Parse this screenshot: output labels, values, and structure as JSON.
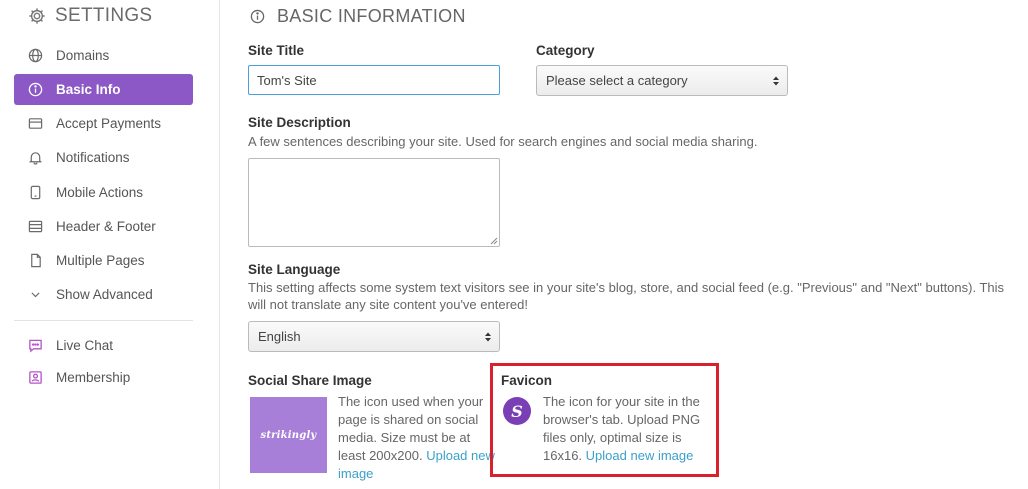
{
  "sidebar": {
    "title": "SETTINGS",
    "title_icon": "gear-icon",
    "items": [
      {
        "label": "Domains",
        "icon": "globe-icon"
      },
      {
        "label": "Basic Info",
        "icon": "info-icon",
        "active": true
      },
      {
        "label": "Accept Payments",
        "icon": "card-icon"
      },
      {
        "label": "Notifications",
        "icon": "bell-icon"
      },
      {
        "label": "Mobile Actions",
        "icon": "phone-icon"
      },
      {
        "label": "Header & Footer",
        "icon": "layout-icon"
      },
      {
        "label": "Multiple Pages",
        "icon": "pages-icon"
      },
      {
        "label": "Show Advanced",
        "icon": "chevron-down-icon"
      }
    ],
    "extras": [
      {
        "label": "Live Chat",
        "icon": "chat-icon"
      },
      {
        "label": "Membership",
        "icon": "member-icon"
      }
    ],
    "active_color": "#8b58c6",
    "extra_icon_color": "#b455c9"
  },
  "main": {
    "title": "BASIC INFORMATION",
    "site_title": {
      "label": "Site Title",
      "value": "Tom's Site"
    },
    "category": {
      "label": "Category",
      "selected": "Please select a category"
    },
    "site_description": {
      "label": "Site Description",
      "help": "A few sentences describing your site. Used for search engines and social media sharing.",
      "value": ""
    },
    "site_language": {
      "label": "Site Language",
      "help": "This setting affects some system text visitors see in your site's blog, store, and social feed (e.g. \"Previous\" and \"Next\" buttons). This will not translate any site content you've entered!",
      "selected": "English"
    },
    "social_share": {
      "label": "Social Share Image",
      "thumb_text": "strikingly",
      "desc": "The icon used when your page is shared on social media. Size must be at least 200x200.",
      "link": "Upload new image"
    },
    "favicon": {
      "label": "Favicon",
      "icon_letter": "S",
      "desc": "The icon for your site in the browser's tab. Upload PNG files only, optimal size is 16x16.",
      "link": "Upload new image"
    }
  },
  "colors": {
    "accent": "#8b58c6",
    "link": "#3aa1c9",
    "input_focus": "#4a9fd6",
    "highlight": "#d8212c",
    "favicon_bg": "#7a3fb4",
    "thumb_bg": "#a77fd9"
  }
}
